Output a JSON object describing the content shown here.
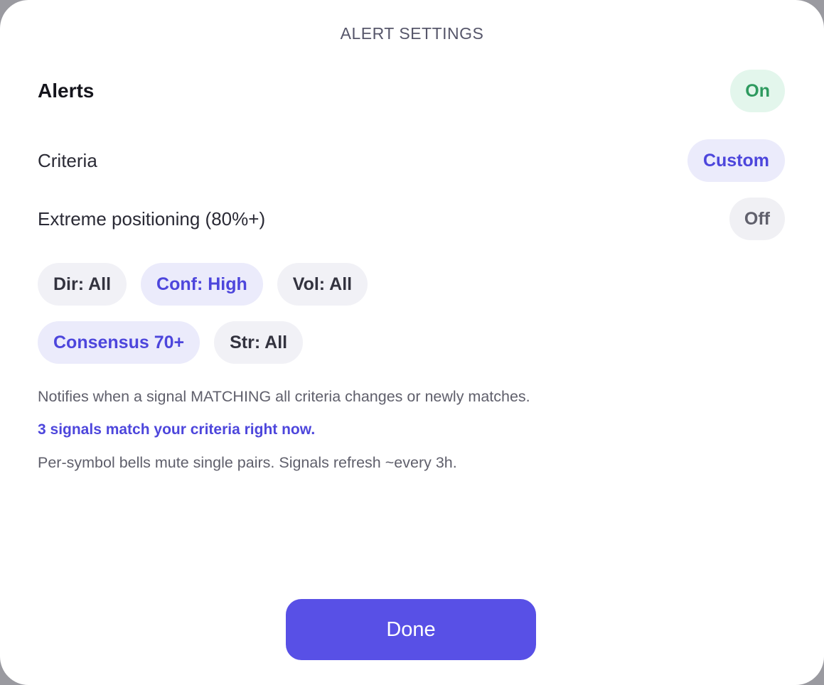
{
  "dialog": {
    "title": "ALERT SETTINGS"
  },
  "settings": {
    "alerts": {
      "label": "Alerts",
      "value": "On"
    },
    "criteria": {
      "label": "Criteria",
      "value": "Custom"
    },
    "extreme": {
      "label": "Extreme positioning (80%+)",
      "value": "Off"
    }
  },
  "filters": [
    {
      "label": "Dir: All",
      "active": false
    },
    {
      "label": "Conf: High",
      "active": true
    },
    {
      "label": "Vol: All",
      "active": false
    },
    {
      "label": "Consensus 70+",
      "active": true
    },
    {
      "label": "Str: All",
      "active": false
    }
  ],
  "notes": {
    "description": "Notifies when a signal MATCHING all criteria changes or newly matches.",
    "match_count": "3 signals match your criteria right now.",
    "footnote": "Per-symbol bells mute single pairs. Signals refresh ~every 3h."
  },
  "actions": {
    "done_label": "Done"
  },
  "colors": {
    "accent": "#5850e6",
    "on_green": "#2e9a5f",
    "chip_active_bg": "#ebebfb"
  }
}
